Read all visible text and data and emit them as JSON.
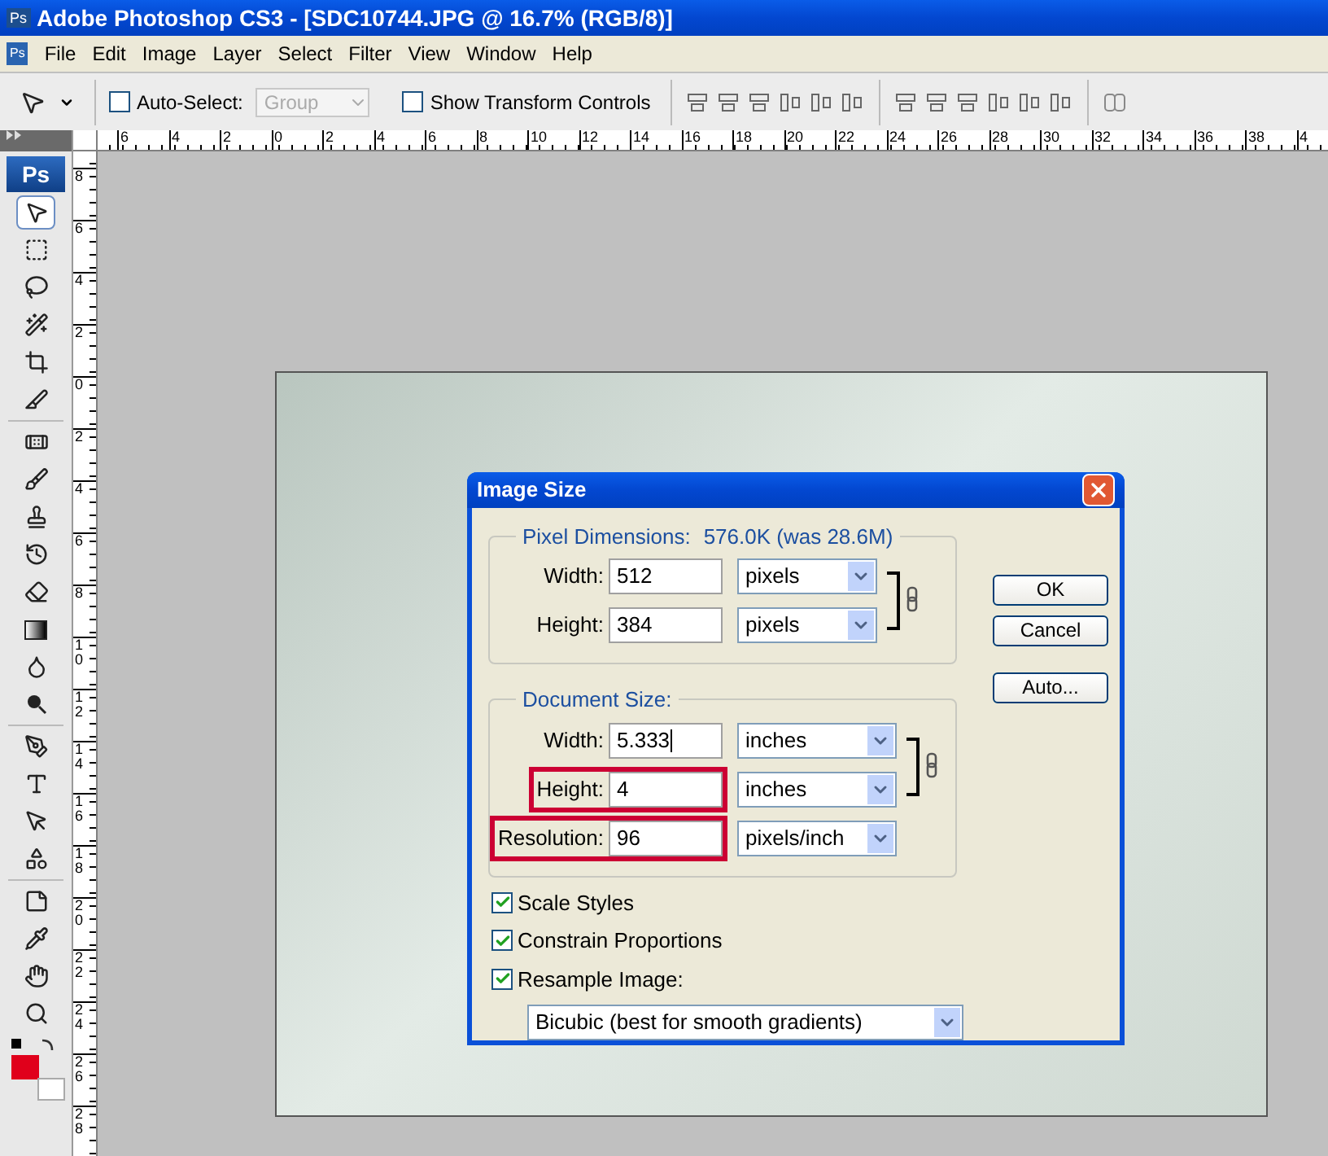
{
  "window": {
    "app_icon": "Ps",
    "title": "Adobe Photoshop CS3 - [SDC10744.JPG @ 16.7% (RGB/8)]"
  },
  "menu": {
    "doc_icon": "Ps",
    "items": [
      {
        "label": "File"
      },
      {
        "label": "Edit"
      },
      {
        "label": "Image"
      },
      {
        "label": "Layer"
      },
      {
        "label": "Select"
      },
      {
        "label": "Filter"
      },
      {
        "label": "View"
      },
      {
        "label": "Window"
      },
      {
        "label": "Help"
      }
    ]
  },
  "options_bar": {
    "auto_select": {
      "label": "Auto-Select:",
      "checked": false
    },
    "group_select": {
      "value": "Group",
      "disabled": true
    },
    "transform_controls": {
      "label": "Show Transform Controls",
      "checked": false
    }
  },
  "horizontal_ruler": [
    "6",
    "4",
    "2",
    "0",
    "2",
    "4",
    "6",
    "8",
    "10",
    "12",
    "14",
    "16",
    "18",
    "20",
    "22",
    "24",
    "26",
    "28",
    "30",
    "32",
    "34",
    "36",
    "38",
    "4"
  ],
  "vertical_ruler": [
    "8",
    "6",
    "4",
    "2",
    "0",
    "2",
    "4",
    "6",
    "8",
    "10",
    "12",
    "14",
    "16",
    "18",
    "20",
    "22",
    "24",
    "26",
    "28"
  ],
  "toolbox": {
    "logo": "Ps",
    "tools": [
      {
        "kind": "move",
        "selected": true
      },
      {
        "kind": "marquee",
        "selected": false
      },
      {
        "kind": "lasso",
        "selected": false
      },
      {
        "kind": "wand",
        "selected": false
      },
      {
        "kind": "crop",
        "selected": false
      },
      {
        "kind": "slice",
        "selected": false
      },
      {
        "kind": "heal",
        "selected": false
      },
      {
        "kind": "brush",
        "selected": false
      },
      {
        "kind": "stamp",
        "selected": false
      },
      {
        "kind": "history",
        "selected": false
      },
      {
        "kind": "eraser",
        "selected": false
      },
      {
        "kind": "gradient",
        "selected": false
      },
      {
        "kind": "blur",
        "selected": false
      },
      {
        "kind": "dodge",
        "selected": false
      },
      {
        "kind": "pen",
        "selected": false
      },
      {
        "kind": "type",
        "selected": false
      },
      {
        "kind": "path",
        "selected": false
      },
      {
        "kind": "shape",
        "selected": false
      },
      {
        "kind": "notes",
        "selected": false
      },
      {
        "kind": "eyedropper",
        "selected": false
      },
      {
        "kind": "hand",
        "selected": false
      },
      {
        "kind": "zoom",
        "selected": false
      }
    ],
    "swatches": [
      {
        "kind": "foreground",
        "color": "#e0001b"
      },
      {
        "kind": "background",
        "color": "#ffffff"
      }
    ]
  },
  "dialog": {
    "title": "Image Size",
    "pixel_dimensions": {
      "label": "Pixel Dimensions:",
      "value": "576.0K (was 28.6M)",
      "rows": [
        {
          "label": "Width:",
          "value": "512",
          "unit": "pixels",
          "highlighted": false,
          "focused": false
        },
        {
          "label": "Height:",
          "value": "384",
          "unit": "pixels",
          "highlighted": false,
          "focused": false
        }
      ]
    },
    "document_size": {
      "label": "Document Size:",
      "rows": [
        {
          "label": "Width:",
          "value": "5.333",
          "unit": "inches",
          "highlighted": false,
          "focused": true
        },
        {
          "label": "Height:",
          "value": "4",
          "unit": "inches",
          "highlighted": true,
          "focused": false
        },
        {
          "label": "Resolution:",
          "value": "96",
          "unit": "pixels/inch",
          "highlighted": true,
          "focused": false
        }
      ]
    },
    "checkboxes": [
      {
        "label": "Scale Styles",
        "checked": true
      },
      {
        "label": "Constrain Proportions",
        "checked": true
      },
      {
        "label": "Resample Image:",
        "checked": true
      }
    ],
    "resample_method": "Bicubic (best for smooth gradients)",
    "buttons": [
      "OK",
      "Cancel",
      "Auto..."
    ]
  }
}
